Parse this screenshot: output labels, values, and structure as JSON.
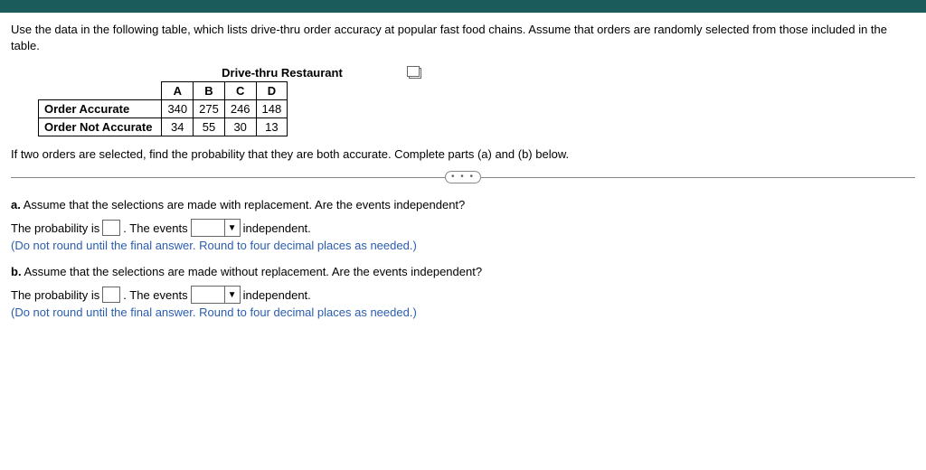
{
  "intro": "Use the data in the following table, which lists drive-thru order accuracy at popular fast food chains. Assume that orders are randomly selected from those included in the table.",
  "table": {
    "title": "Drive-thru Restaurant",
    "columns": [
      "A",
      "B",
      "C",
      "D"
    ],
    "rows": [
      {
        "label": "Order Accurate",
        "vals": [
          "340",
          "275",
          "246",
          "148"
        ]
      },
      {
        "label": "Order Not Accurate",
        "vals": [
          "34",
          "55",
          "30",
          "13"
        ]
      }
    ]
  },
  "instruction": "If two orders are selected, find the probability that they are both accurate. Complete parts (a) and (b) below.",
  "pill": "• • •",
  "partA": {
    "label": "a.",
    "question": "Assume that the selections are made with replacement. Are the events independent?",
    "line": {
      "before_box": "The probability is",
      "after_box": ". The events",
      "after_dd": "independent."
    },
    "note": "(Do not round until the final answer. Round to four decimal places as needed.)"
  },
  "partB": {
    "label": "b.",
    "question": "Assume that the selections are made without replacement. Are the events independent?",
    "line": {
      "before_box": "The probability is",
      "after_box": ". The events",
      "after_dd": "independent."
    },
    "note": "(Do not round until the final answer. Round to four decimal places as needed.)"
  },
  "chart_data": {
    "type": "table",
    "title": "Drive-thru Restaurant order accuracy",
    "columns": [
      "A",
      "B",
      "C",
      "D"
    ],
    "rows": {
      "Order Accurate": [
        340,
        275,
        246,
        148
      ],
      "Order Not Accurate": [
        34,
        55,
        30,
        13
      ]
    }
  }
}
